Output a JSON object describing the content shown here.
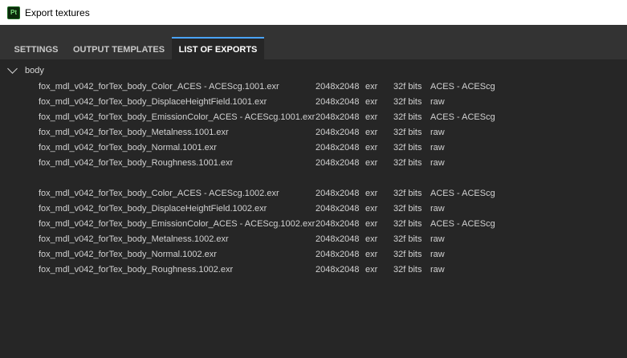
{
  "window": {
    "title": "Export textures",
    "app_icon": "Pt"
  },
  "tabs": [
    {
      "label": "SETTINGS",
      "active": false
    },
    {
      "label": "OUTPUT TEMPLATES",
      "active": false
    },
    {
      "label": "LIST OF EXPORTS",
      "active": true
    }
  ],
  "group": {
    "label": "body",
    "expanded": true
  },
  "exports": [
    {
      "name": "fox_mdl_v042_forTex_body_Color_ACES - ACEScg.1001.exr",
      "resolution": "2048x2048",
      "format": "exr",
      "bits": "32f bits",
      "colorspace": "ACES - ACEScg"
    },
    {
      "name": "fox_mdl_v042_forTex_body_DisplaceHeightField.1001.exr",
      "resolution": "2048x2048",
      "format": "exr",
      "bits": "32f bits",
      "colorspace": "raw"
    },
    {
      "name": "fox_mdl_v042_forTex_body_EmissionColor_ACES - ACEScg.1001.exr",
      "resolution": "2048x2048",
      "format": "exr",
      "bits": "32f bits",
      "colorspace": "ACES - ACEScg"
    },
    {
      "name": "fox_mdl_v042_forTex_body_Metalness.1001.exr",
      "resolution": "2048x2048",
      "format": "exr",
      "bits": "32f bits",
      "colorspace": "raw"
    },
    {
      "name": "fox_mdl_v042_forTex_body_Normal.1001.exr",
      "resolution": "2048x2048",
      "format": "exr",
      "bits": "32f bits",
      "colorspace": "raw"
    },
    {
      "name": "fox_mdl_v042_forTex_body_Roughness.1001.exr",
      "resolution": "2048x2048",
      "format": "exr",
      "bits": "32f bits",
      "colorspace": "raw"
    },
    {
      "name": "fox_mdl_v042_forTex_body_Color_ACES - ACEScg.1002.exr",
      "resolution": "2048x2048",
      "format": "exr",
      "bits": "32f bits",
      "colorspace": "ACES - ACEScg"
    },
    {
      "name": "fox_mdl_v042_forTex_body_DisplaceHeightField.1002.exr",
      "resolution": "2048x2048",
      "format": "exr",
      "bits": "32f bits",
      "colorspace": "raw"
    },
    {
      "name": "fox_mdl_v042_forTex_body_EmissionColor_ACES - ACEScg.1002.exr",
      "resolution": "2048x2048",
      "format": "exr",
      "bits": "32f bits",
      "colorspace": "ACES - ACEScg"
    },
    {
      "name": "fox_mdl_v042_forTex_body_Metalness.1002.exr",
      "resolution": "2048x2048",
      "format": "exr",
      "bits": "32f bits",
      "colorspace": "raw"
    },
    {
      "name": "fox_mdl_v042_forTex_body_Normal.1002.exr",
      "resolution": "2048x2048",
      "format": "exr",
      "bits": "32f bits",
      "colorspace": "raw"
    },
    {
      "name": "fox_mdl_v042_forTex_body_Roughness.1002.exr",
      "resolution": "2048x2048",
      "format": "exr",
      "bits": "32f bits",
      "colorspace": "raw"
    }
  ],
  "colors": {
    "background": "#262626",
    "tabbar": "#333333",
    "active_tab_accent": "#4aa3ff"
  }
}
